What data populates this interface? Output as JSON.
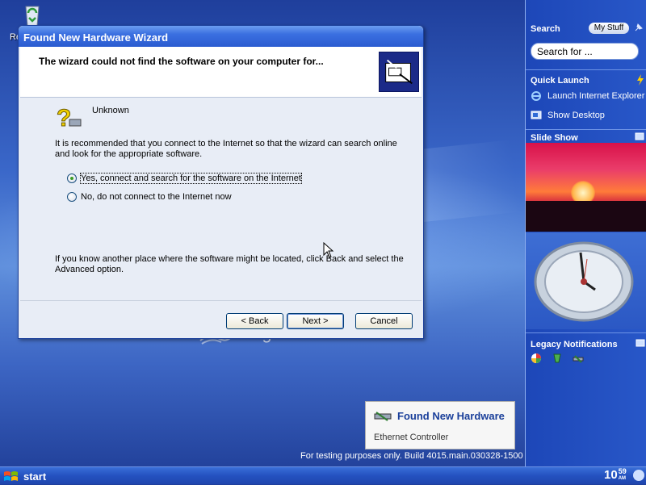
{
  "desktop": {
    "recycle_bin_label": "Re",
    "brand_text": "longhorn milestone five"
  },
  "wizard": {
    "title": "Found New Hardware Wizard",
    "header_text": "The wizard could not find the software on your computer for...",
    "device_name": "Unknown",
    "description": "It is recommended that you connect to the Internet so that the wizard can search online and look for the appropriate software.",
    "options": [
      {
        "label": "Yes, connect and search for the software on the Internet",
        "checked": true
      },
      {
        "label": "No, do not connect to the Internet now",
        "checked": false
      }
    ],
    "other_place_text": "If you know another place where the software might be located, click Back and select the Advanced option.",
    "buttons": {
      "back": "< Back",
      "next": "Next >",
      "cancel": "Cancel"
    }
  },
  "sidebar": {
    "search_title": "Search",
    "my_stuff_label": "My Stuff",
    "search_placeholder": "Search for ...",
    "quick_launch_title": "Quick Launch",
    "quick_launch_items": [
      {
        "label": "Launch Internet Explorer",
        "icon": "ie-icon"
      },
      {
        "label": "Show Desktop",
        "icon": "desktop-icon"
      }
    ],
    "slide_show_title": "Slide Show",
    "legacy_title": "Legacy Notifications"
  },
  "balloon": {
    "title": "Found New Hardware",
    "body": "Ethernet Controller"
  },
  "build_text": "For testing purposes only. Build 4015.main.030328-1500",
  "taskbar": {
    "start_label": "start",
    "clock_hour": "10",
    "clock_minute": "59",
    "clock_ampm": "AM"
  },
  "colors": {
    "titlebar": "#2a5bd0",
    "sidebar": "#2857c8",
    "taskbar": "#2451c0",
    "balloon_title": "#1a3f9a"
  }
}
